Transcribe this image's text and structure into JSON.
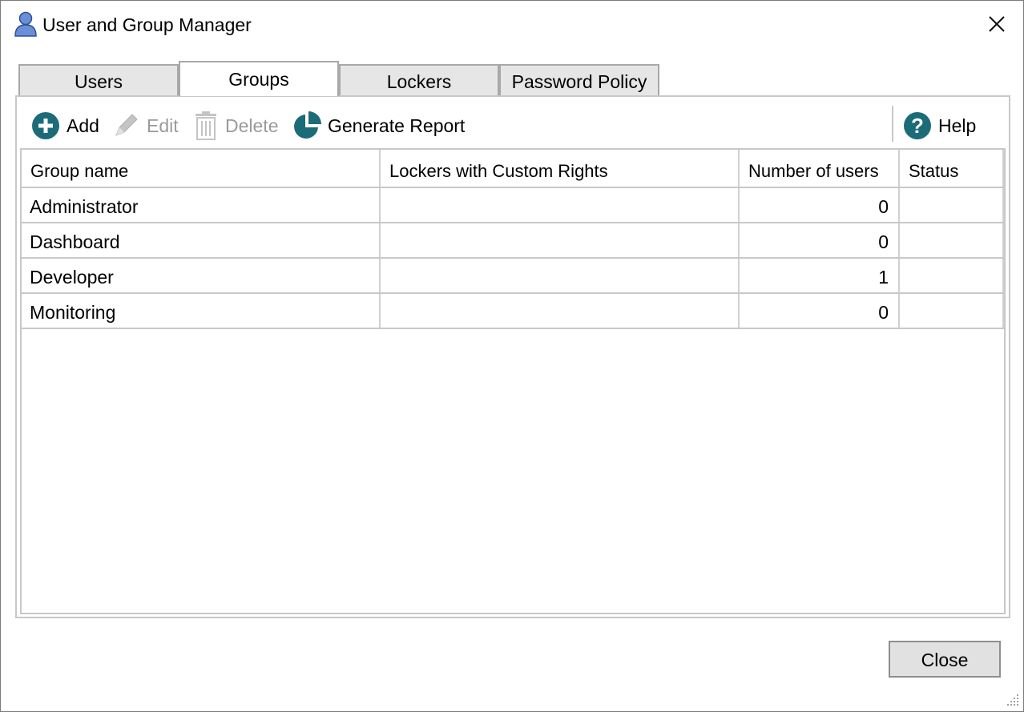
{
  "window": {
    "title": "User and Group Manager",
    "title_icon": "user-icon",
    "close_icon": "close-icon"
  },
  "tabs": [
    {
      "label": "Users",
      "active": false
    },
    {
      "label": "Groups",
      "active": true
    },
    {
      "label": "Lockers",
      "active": false
    },
    {
      "label": "Password Policy",
      "active": false
    }
  ],
  "toolbar": {
    "add": {
      "label": "Add",
      "icon": "plus-circle-icon",
      "enabled": true
    },
    "edit": {
      "label": "Edit",
      "icon": "pencil-icon",
      "enabled": false
    },
    "delete": {
      "label": "Delete",
      "icon": "trash-icon",
      "enabled": false
    },
    "report": {
      "label": "Generate Report",
      "icon": "pie-chart-icon",
      "enabled": true
    },
    "help": {
      "label": "Help",
      "icon": "help-icon",
      "enabled": true
    }
  },
  "table": {
    "columns": [
      "Group name",
      "Lockers with Custom Rights",
      "Number of users",
      "Status"
    ],
    "rows": [
      {
        "group": "Administrator",
        "lockers": "",
        "users": "0",
        "status": ""
      },
      {
        "group": "Dashboard",
        "lockers": "",
        "users": "0",
        "status": ""
      },
      {
        "group": "Developer",
        "lockers": "",
        "users": "1",
        "status": ""
      },
      {
        "group": "Monitoring",
        "lockers": "",
        "users": "0",
        "status": ""
      }
    ]
  },
  "footer": {
    "close_label": "Close"
  },
  "colors": {
    "accent_teal": "#1c6b78",
    "disabled_gray": "#9a9a9a",
    "title_icon_blue": "#6b8fd6"
  }
}
